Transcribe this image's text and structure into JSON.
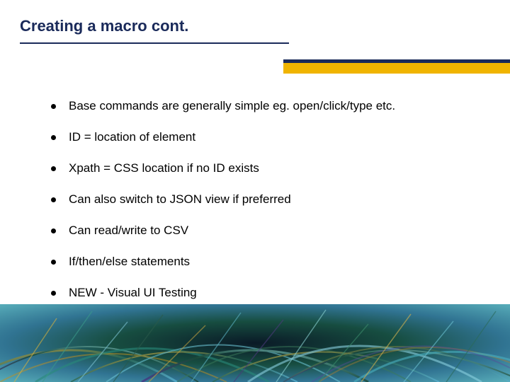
{
  "title": "Creating a macro cont.",
  "bullets": [
    "Base commands are generally simple eg. open/click/type etc.",
    "ID = location of element",
    "Xpath = CSS location if no ID exists",
    "Can also switch to JSON view if preferred",
    "Can read/write to CSV",
    "If/then/else statements",
    "NEW - Visual UI Testing"
  ],
  "colors": {
    "title": "#1a2a5a",
    "accent": "#f0b400"
  }
}
